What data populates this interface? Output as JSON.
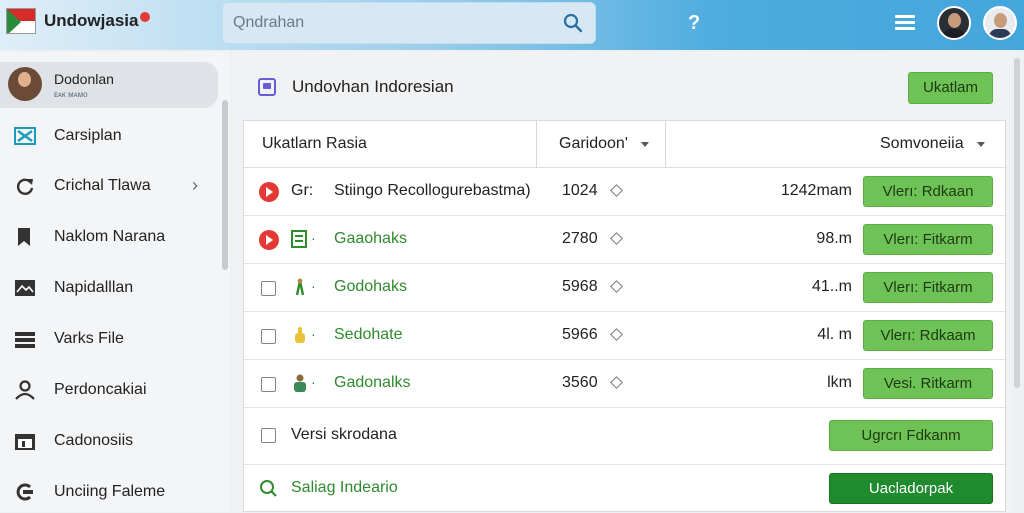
{
  "header": {
    "brand": "Undowjasia",
    "search_placeholder": "Qndrahan",
    "help_label": "?"
  },
  "colors": {
    "accent": "#4eacdf",
    "primary_button": "#6fc255",
    "dark_button": "#1f8a2e",
    "play_badge": "#e53935"
  },
  "sidebar": {
    "user": {
      "name": "Dodonlan",
      "sub": "ᴇᴀᴋ ᴍᴀᴍᴏ"
    },
    "items": [
      {
        "label": "Carsiplan",
        "icon": "x-grid-icon"
      },
      {
        "label": "Crichal Tlawa",
        "icon": "refresh-icon",
        "chevron": "›"
      },
      {
        "label": "Naklom Narana",
        "icon": "bookmark-icon"
      },
      {
        "label": "Napidalllan",
        "icon": "image-icon"
      },
      {
        "label": "Varks File",
        "icon": "stack-icon"
      },
      {
        "label": "Perdoncakiai",
        "icon": "person-icon"
      },
      {
        "label": "Cadonosiis",
        "icon": "calendar-icon"
      },
      {
        "label": "Unciing Faleme",
        "icon": "sync-icon"
      }
    ]
  },
  "page": {
    "title": "Undovhan Indoresian",
    "primary_action": "Ukatlam"
  },
  "filters": {
    "label": "Ukatlarn Rasia",
    "select_1": "Garidoon'",
    "select_2": "Somvoneiia"
  },
  "rows": [
    {
      "lead": "play",
      "prefix": "Gr:",
      "name": "Stiingo Recollogurebastma)",
      "name_dark": true,
      "number": "1024",
      "value": "1242mam",
      "action": "Vlerı: Rdkaan"
    },
    {
      "lead": "play",
      "prefix": "·",
      "name": "Gaaohaks",
      "number": "2780",
      "value": "98.m",
      "action": "Vlerı: Fitkarm"
    },
    {
      "lead": "checkbox",
      "prefix": "·",
      "name": "Godohaks",
      "number": "5968",
      "value": "41..m",
      "action": "Vlerı: Fitkarm"
    },
    {
      "lead": "checkbox",
      "prefix": "·",
      "name": "Sedohate",
      "number": "5966",
      "value": "4l. m",
      "action": "Vlerı: Rdkaam"
    },
    {
      "lead": "checkbox",
      "prefix": "·",
      "name": "Gadonalks",
      "number": "3560",
      "value": "lkm",
      "action": "Vesi. Ritkarm"
    },
    {
      "lead": "checkbox",
      "name": "Versi skrodana",
      "name_dark": true,
      "action": "Ugrcrı  Fdkanm"
    },
    {
      "lead": "search",
      "name": "Saliag Indeario",
      "action": "Uacladorpak"
    }
  ]
}
